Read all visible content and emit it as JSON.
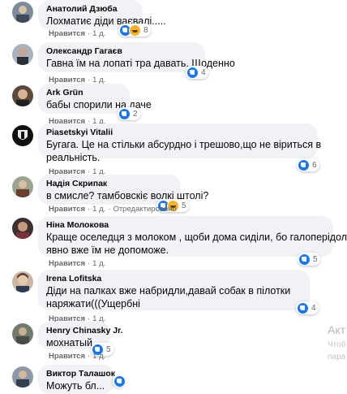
{
  "comments": [
    {
      "author": "Анатолий Дзюба",
      "lines": [
        "Лохматиє діди ваєвалі....."
      ],
      "like_label": "Нравится",
      "time": "1 д.",
      "reaction_count": "8",
      "reactions": [
        "like",
        "haha"
      ]
    },
    {
      "author": "Олександр Гагаєв",
      "lines": [
        "Гавна їм на лопаті тра давать. Щоденно"
      ],
      "like_label": "Нравится",
      "time": "1 д.",
      "reaction_count": "4",
      "reactions": [
        "like"
      ]
    },
    {
      "author": "Ark Grün",
      "lines": [
        "бабы спорили на даче"
      ],
      "like_label": "Нравится",
      "time": "1 д.",
      "reaction_count": "2",
      "reactions": [
        "like"
      ]
    },
    {
      "author": "Piasetskyi Vitalii",
      "lines": [
        "Бугага. Це на стільки абсурдно і трешово,що не віриться в",
        "реальність."
      ],
      "like_label": "Нравится",
      "time": "1 д.",
      "reaction_count": "6",
      "reactions": [
        "like"
      ]
    },
    {
      "author": "Надія Скрипак",
      "lines": [
        "в смисле? тамбовскіє волкі штолі?"
      ],
      "like_label": "Нравится",
      "time": "1 д.",
      "edited_label": "Отредактировано",
      "reaction_count": "5",
      "reactions": [
        "like",
        "haha"
      ]
    },
    {
      "author": "Ніна Молокова",
      "lines": [
        "Краще оселедця з молоком , щоби дома сиділи, бо галоперідол",
        "явно вже їм не допоможе."
      ],
      "like_label": "Нравится",
      "time": "1 д.",
      "reaction_count": "5",
      "reactions": [
        "like"
      ]
    },
    {
      "author": "Irena Lofitska",
      "lines": [
        "Діди на палках вже набридли,давай собак в пілотки",
        "наряжати(((Ущербні"
      ],
      "like_label": "Нравится",
      "time": "1 д.",
      "reaction_count": "4",
      "reactions": [
        "like"
      ]
    },
    {
      "author": "Henry Chinasky Jr.",
      "lines": [
        "мохнатый"
      ],
      "like_label": "Нравится",
      "time": "1 д.",
      "reaction_count": "5",
      "reactions": [
        "like"
      ]
    },
    {
      "author": "Виктор Талашок",
      "lines": [
        "Можуть бл..."
      ],
      "like_label": "",
      "time": "",
      "reaction_count": "",
      "reactions": [
        "like"
      ]
    }
  ],
  "watermark": {
    "title": "Акт",
    "line1": "Чтоб",
    "line2": "пара"
  },
  "colors": {
    "bubble": "#f0f2f5",
    "like_blue": "#1877f2",
    "haha_yellow": "#f7b125",
    "meta_gray": "#65676b"
  }
}
